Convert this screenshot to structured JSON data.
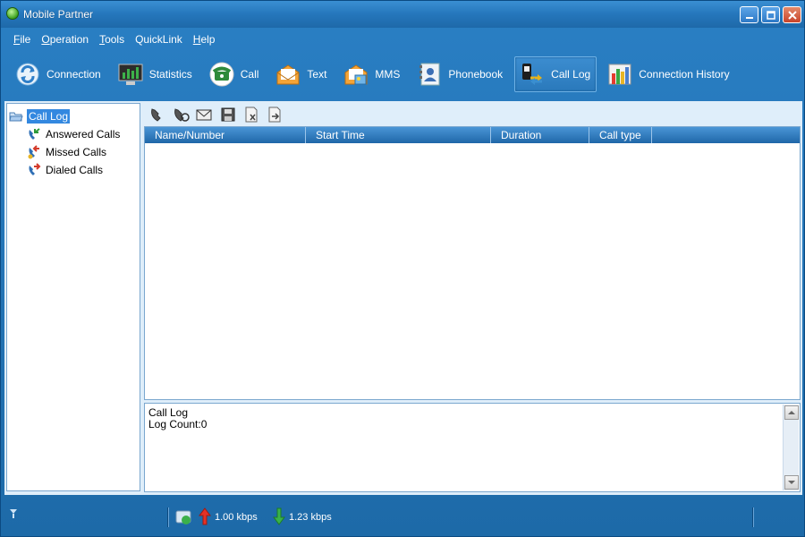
{
  "window": {
    "title": "Mobile Partner"
  },
  "menu": [
    "File",
    "Operation",
    "Tools",
    "QuickLink",
    "Help"
  ],
  "menu_underline": [
    "F",
    "O",
    "T",
    "",
    "H"
  ],
  "toolbar": [
    {
      "label": "Connection",
      "icon": "connection-icon"
    },
    {
      "label": "Statistics",
      "icon": "statistics-icon"
    },
    {
      "label": "Call",
      "icon": "call-icon"
    },
    {
      "label": "Text",
      "icon": "text-icon"
    },
    {
      "label": "MMS",
      "icon": "mms-icon"
    },
    {
      "label": "Phonebook",
      "icon": "phonebook-icon"
    },
    {
      "label": "Call Log",
      "icon": "call-log-icon",
      "active": true
    },
    {
      "label": "Connection History",
      "icon": "connection-history-icon"
    }
  ],
  "tree": {
    "root": "Call Log",
    "children": [
      "Answered Calls",
      "Missed Calls",
      "Dialed Calls"
    ]
  },
  "actions": [
    "call-icon",
    "callback-icon",
    "message-icon",
    "save-icon",
    "delete-icon",
    "export-icon"
  ],
  "list": {
    "columns": [
      "Name/Number",
      "Start Time",
      "Duration",
      "Call type"
    ],
    "rows": []
  },
  "detail": {
    "title": "Call Log",
    "count": "Log Count:0"
  },
  "status": {
    "upload": "1.00 kbps",
    "download": "1.23 kbps"
  },
  "colors": {
    "accent": "#1d6aa8",
    "selection": "#3388e0"
  }
}
